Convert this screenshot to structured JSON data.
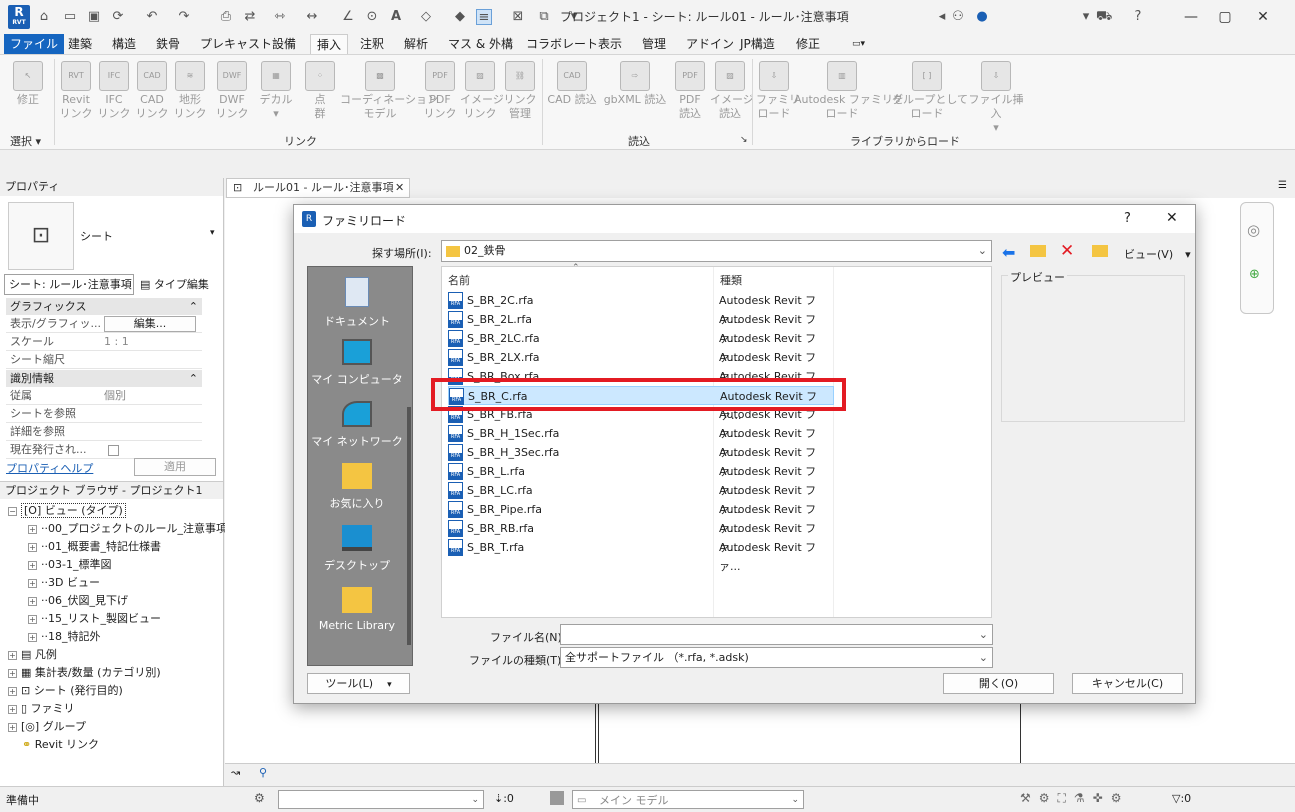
{
  "window": {
    "title": "プロジェクト1 - シート: ルール01 - ルール･注意事項",
    "app_icon": "R",
    "app_icon_sub": "RVT"
  },
  "menu_tabs": [
    "ファイル",
    "建築",
    "構造",
    "鉄骨",
    "プレキャスト",
    "設備",
    "挿入",
    "注釈",
    "解析",
    "マス & 外構",
    "コラボレート",
    "表示",
    "管理",
    "アドイン",
    "JP構造",
    "修正"
  ],
  "active_tab": "挿入",
  "ribbon": {
    "buttons": [
      {
        "label": "修正",
        "icon": "cursor-icon"
      },
      {
        "label": "Revit\nリンク",
        "icon": "revit-link-icon"
      },
      {
        "label": "IFC\nリンク",
        "icon": "ifc-link-icon"
      },
      {
        "label": "CAD\nリンク",
        "icon": "cad-link-icon"
      },
      {
        "label": "地形\nリンク",
        "icon": "topo-link-icon"
      },
      {
        "label": "DWF\nリンク",
        "icon": "dwf-link-icon"
      },
      {
        "label": "デカル",
        "icon": "decal-icon"
      },
      {
        "label": "点\n群",
        "icon": "point-cloud-icon"
      },
      {
        "label": "コーディネーション\nモデル",
        "icon": "coordination-model-icon"
      },
      {
        "label": "PDF\nリンク",
        "icon": "pdf-link-icon"
      },
      {
        "label": "イメージ\nリンク",
        "icon": "image-link-icon"
      },
      {
        "label": "リンク\n管理",
        "icon": "manage-links-icon"
      },
      {
        "label": "CAD 読込",
        "icon": "cad-import-icon"
      },
      {
        "label": "gbXML 読込",
        "icon": "gbxml-import-icon"
      },
      {
        "label": "PDF\n読込",
        "icon": "pdf-import-icon"
      },
      {
        "label": "イメージ\n読込",
        "icon": "image-import-icon"
      },
      {
        "label": "ファミリ\nロード",
        "icon": "load-family-icon"
      },
      {
        "label": "Autodesk ファミリを\nロード",
        "icon": "autodesk-family-icon"
      },
      {
        "label": "グループとして\nロード",
        "icon": "load-group-icon"
      },
      {
        "label": "ファイル挿入",
        "icon": "insert-file-icon"
      }
    ],
    "panels": [
      "選択",
      "リンク",
      "読込",
      "ライブラリからロード"
    ]
  },
  "properties": {
    "title": "プロパティ",
    "type_name": "シート",
    "selector": "シート: ルール･注意事項",
    "edit_type": "タイプ編集",
    "groups": [
      {
        "name": "グラフィックス",
        "rows": [
          {
            "k": "表示/グラフィッ...",
            "v": "編集..."
          },
          {
            "k": "スケール",
            "v": "1 : 1"
          },
          {
            "k": "シート縮尺",
            "v": ""
          }
        ]
      },
      {
        "name": "識別情報",
        "rows": [
          {
            "k": "従属",
            "v": "個別"
          },
          {
            "k": "シートを参照",
            "v": ""
          },
          {
            "k": "詳細を参照",
            "v": ""
          },
          {
            "k": "現在発行され...",
            "v": ""
          }
        ]
      }
    ],
    "help_link": "プロパティヘルプ",
    "apply": "適用"
  },
  "browser": {
    "title": "プロジェクト ブラウザ - プロジェクト1",
    "root": "ビュー (タイプ)",
    "views": [
      "00_プロジェクトのルール_注意事項",
      "01_概要書_特記仕様書",
      "03-1_標準図",
      "3D ビュー",
      "06_伏図_見下げ",
      "15_リスト_製図ビュー",
      "18_特記外"
    ],
    "categories": [
      "凡例",
      "集計表/数量 (カテゴリ別)",
      "シート (発行目的)",
      "ファミリ",
      "グループ",
      "Revit リンク"
    ]
  },
  "view_tab": "ルール01 - ルール･注意事項",
  "status": {
    "left": "準備中",
    "count": ":0",
    "model": "メイン モデル",
    "filter_count": ":0"
  },
  "dialog": {
    "title": "ファミリロード",
    "help": "?",
    "look_in_label": "探す場所(I):",
    "look_in_value": "02_鉄骨",
    "places": [
      "ドキュメント",
      "マイ コンピュータ",
      "マイ ネットワーク",
      "お気に入り",
      "デスクトップ",
      "Metric Library"
    ],
    "columns": {
      "name": "名前",
      "type": "種類"
    },
    "files": [
      {
        "name": "S_BR_2C.rfa",
        "type": "Autodesk Revit ファ..."
      },
      {
        "name": "S_BR_2L.rfa",
        "type": "Autodesk Revit ファ..."
      },
      {
        "name": "S_BR_2LC.rfa",
        "type": "Autodesk Revit ファ..."
      },
      {
        "name": "S_BR_2LX.rfa",
        "type": "Autodesk Revit ファ..."
      },
      {
        "name": "S_BR_Box.rfa",
        "type": "Autodesk Revit ファ..."
      },
      {
        "name": "S_BR_C.rfa",
        "type": "Autodesk Revit ファ..."
      },
      {
        "name": "S_BR_FB.rfa",
        "type": "Autodesk Revit ファ..."
      },
      {
        "name": "S_BR_H_1Sec.rfa",
        "type": "Autodesk Revit ファ..."
      },
      {
        "name": "S_BR_H_3Sec.rfa",
        "type": "Autodesk Revit ファ..."
      },
      {
        "name": "S_BR_L.rfa",
        "type": "Autodesk Revit ファ..."
      },
      {
        "name": "S_BR_LC.rfa",
        "type": "Autodesk Revit ファ..."
      },
      {
        "name": "S_BR_Pipe.rfa",
        "type": "Autodesk Revit ファ..."
      },
      {
        "name": "S_BR_RB.rfa",
        "type": "Autodesk Revit ファ..."
      },
      {
        "name": "S_BR_T.rfa",
        "type": "Autodesk Revit ファ..."
      }
    ],
    "selected_file": "S_BR_C.rfa",
    "preview_label": "プレビュー",
    "view_menu": "ビュー(V)",
    "filename_label": "ファイル名(N):",
    "filename_value": "",
    "filetype_label": "ファイルの種類(T):",
    "filetype_value": "全サポートファイル （*.rfa, *.adsk)",
    "tools": "ツール(L)",
    "open": "開く(O)",
    "cancel": "キャンセル(C)"
  },
  "colors": {
    "accent": "#1565c0",
    "highlight": "#e31b23",
    "selection": "#cce8ff"
  }
}
